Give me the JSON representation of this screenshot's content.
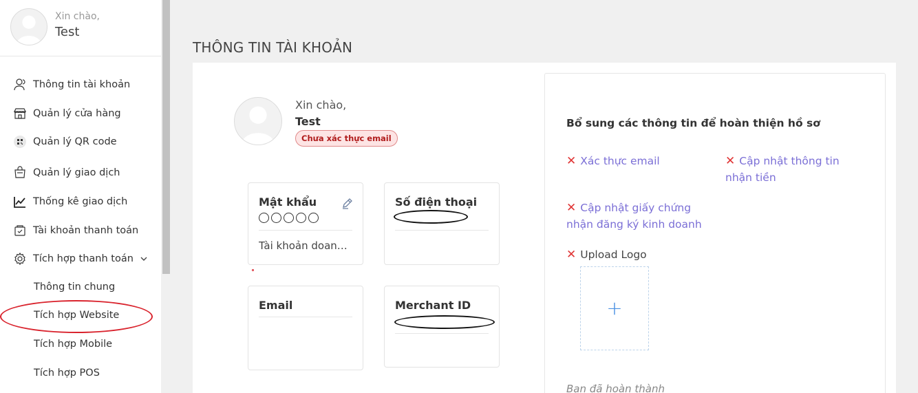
{
  "sidebar": {
    "greeting": "Xin chào,",
    "username": "Test",
    "menu": [
      {
        "label": "Thông tin tài khoản",
        "icon": "user-icon"
      },
      {
        "label": "Quản lý cửa hàng",
        "icon": "store-icon"
      },
      {
        "label": "Quản lý QR code",
        "icon": "qr-code-icon"
      },
      {
        "label": "Quản lý giao dịch",
        "icon": "cart-icon"
      },
      {
        "label": "Thống kê giao dịch",
        "icon": "chart-line-icon"
      },
      {
        "label": "Tài khoản thanh toán",
        "icon": "wallet-icon"
      },
      {
        "label": "Tích hợp thanh toán",
        "icon": "gear-icon"
      }
    ],
    "submenu": [
      "Thông tin chung",
      "Tích hợp Website",
      "Tích hợp Mobile",
      "Tích hợp POS"
    ]
  },
  "page": {
    "title": "THÔNG TIN TÀI KHOẢN"
  },
  "profile": {
    "greeting": "Xin chào,",
    "name": "Test",
    "badge": "Chưa xác thực email"
  },
  "cards": {
    "password": {
      "label": "Mật khẩu",
      "sub": "Tài khoản doanh nghiệp"
    },
    "phone": {
      "label": "Số điện thoại"
    },
    "email": {
      "label": "Email"
    },
    "merchant": {
      "label": "Merchant ID"
    }
  },
  "completion": {
    "title": "Bổ sung các thông tin để hoàn thiện hồ sơ",
    "verify_email": "Xác thực email",
    "update_receive": "Cập nhật thông tin nhận tiền",
    "update_license": "Cập nhật giấy chứng nhận đăng ký kinh doanh",
    "upload_logo": "Upload Logo",
    "upload_plus": "+",
    "footer": "Bạn đã hoàn thành"
  },
  "colors": {
    "accent": "#7b6fd6",
    "danger": "#e03535",
    "badge_bg": "#fde4e4"
  }
}
